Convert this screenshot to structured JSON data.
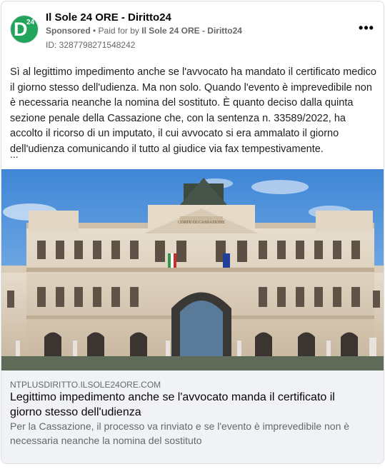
{
  "post": {
    "page_name": "Il Sole 24 ORE - Diritto24",
    "avatar": {
      "letter": "D",
      "number": "24",
      "color": "#22a55a"
    },
    "sponsored_label": "Sponsored",
    "separator": " • ",
    "paid_for_prefix": "Paid for by ",
    "paid_for_name": "Il Sole 24 ORE - Diritto24",
    "ad_id": "ID: 3287798271548242",
    "more_icon": "more-options-icon",
    "more_glyph": "•••",
    "text": "Sì al legittimo impedimento anche se l'avvocato ha mandato il certificato medico il giorno stesso dell'udienza. Ma non solo. Quando l'evento è imprevedibile non è necessaria neanche la nomina del sostituto. È quanto deciso dalla quinta sezione penale della Cassazione che, con la sentenza n. 33589/2022, ha accolto il ricorso di un imputato, il cui avvocato si era ammalato il giorno dell'udienza comunicando il tutto al giudice via fax tempestivamente.",
    "ellipsis": "..."
  },
  "image": {
    "building_sign": "CORTE DI CASSAZIONE"
  },
  "link": {
    "domain": "NTPLUSDIRITTO.ILSOLE24ORE.COM",
    "title": "Legittimo impedimento anche se l'avvocato manda il certificato il giorno stesso dell'udienza",
    "description": "Per la Cassazione, il processo va rinviato e se l'evento è imprevedibile non è necessaria neanche la nomina del sostituto"
  }
}
